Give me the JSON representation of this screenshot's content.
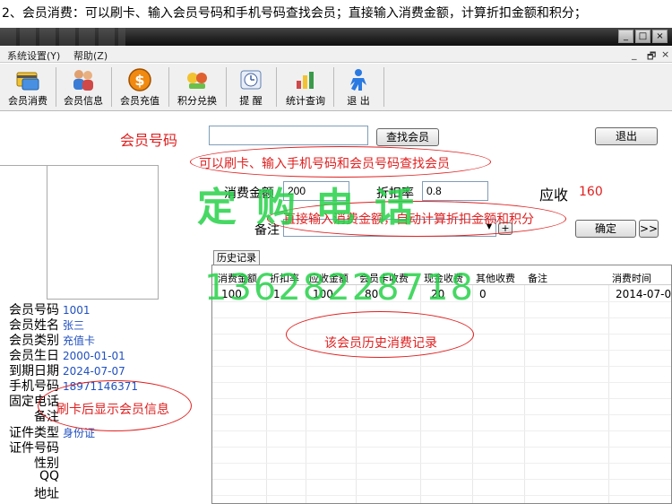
{
  "caption": "2、会员消费：可以刷卡、输入会员号码和手机号码查找会员；直接输入消费金额，计算折扣金额和积分；",
  "window": {
    "min": "_",
    "max": "□",
    "close": "×"
  },
  "menu": {
    "system": "系统设置(Y)",
    "help": "帮助(Z)",
    "ctl_min": "_",
    "ctl_max": "🗗",
    "ctl_close": "×"
  },
  "toolbar": [
    {
      "label": "会员消费",
      "icon": "card-payment-icon"
    },
    {
      "label": "会员信息",
      "icon": "members-icon"
    },
    {
      "label": "会员充值",
      "icon": "coin-recharge-icon"
    },
    {
      "label": "积分兑换",
      "icon": "points-gift-icon"
    },
    {
      "label": "提 醒",
      "icon": "reminder-icon"
    },
    {
      "label": "统计查询",
      "icon": "statistics-icon"
    },
    {
      "label": "退 出",
      "icon": "exit-person-icon"
    }
  ],
  "search": {
    "member_no_label": "会员号码",
    "member_no_value": "",
    "find_button": "查找会员",
    "exit_button": "退出",
    "hint": "可以刷卡、输入手机号码和会员号码查找会员"
  },
  "consume": {
    "amount_label": "消费金额",
    "amount_value": "200",
    "discount_label": "折扣率",
    "discount_value": "0.8",
    "due_label": "应收",
    "due_value": "160",
    "remark_label": "备注",
    "remark_value": "",
    "plus": "+",
    "confirm_button": "确定",
    "next_button": ">>",
    "hint": "直接输入消费金额，自动计算折扣金额和积分"
  },
  "member": {
    "rows": [
      {
        "key": "会员号码",
        "value": "1001"
      },
      {
        "key": "会员姓名",
        "value": "张三"
      },
      {
        "key": "会员类别",
        "value": "充值卡"
      },
      {
        "key": "会员生日",
        "value": "2000-01-01"
      },
      {
        "key": "到期日期",
        "value": "2024-07-07"
      },
      {
        "key": "手机号码",
        "value": "18971146371"
      },
      {
        "key": "固定电话",
        "value": ""
      },
      {
        "key": "备注",
        "value": ""
      },
      {
        "key": "证件类型",
        "value": "身份证"
      },
      {
        "key": "证件号码",
        "value": ""
      },
      {
        "key": "性别",
        "value": ""
      },
      {
        "key": "QQ",
        "value": ""
      },
      {
        "key": "地址",
        "value": ""
      }
    ],
    "hint": "刷卡后显示会员信息"
  },
  "history": {
    "tab": "历史记录",
    "columns": [
      "消费金额",
      "折扣率",
      "应收金额",
      "会员卡收费",
      "现金收费",
      "其他收费",
      "备注",
      "消费时间"
    ],
    "rows": [
      [
        "100",
        "1",
        "100",
        "80",
        "20",
        "0",
        "",
        "2014-07-08"
      ]
    ],
    "hint": "该会员历史消费记录"
  },
  "watermark": {
    "line1": "定购电话",
    "line2": "13628228718"
  },
  "colors": {
    "accent_red": "#e02020",
    "watermark_green": "#27d24a",
    "value_blue": "#2050c0"
  }
}
